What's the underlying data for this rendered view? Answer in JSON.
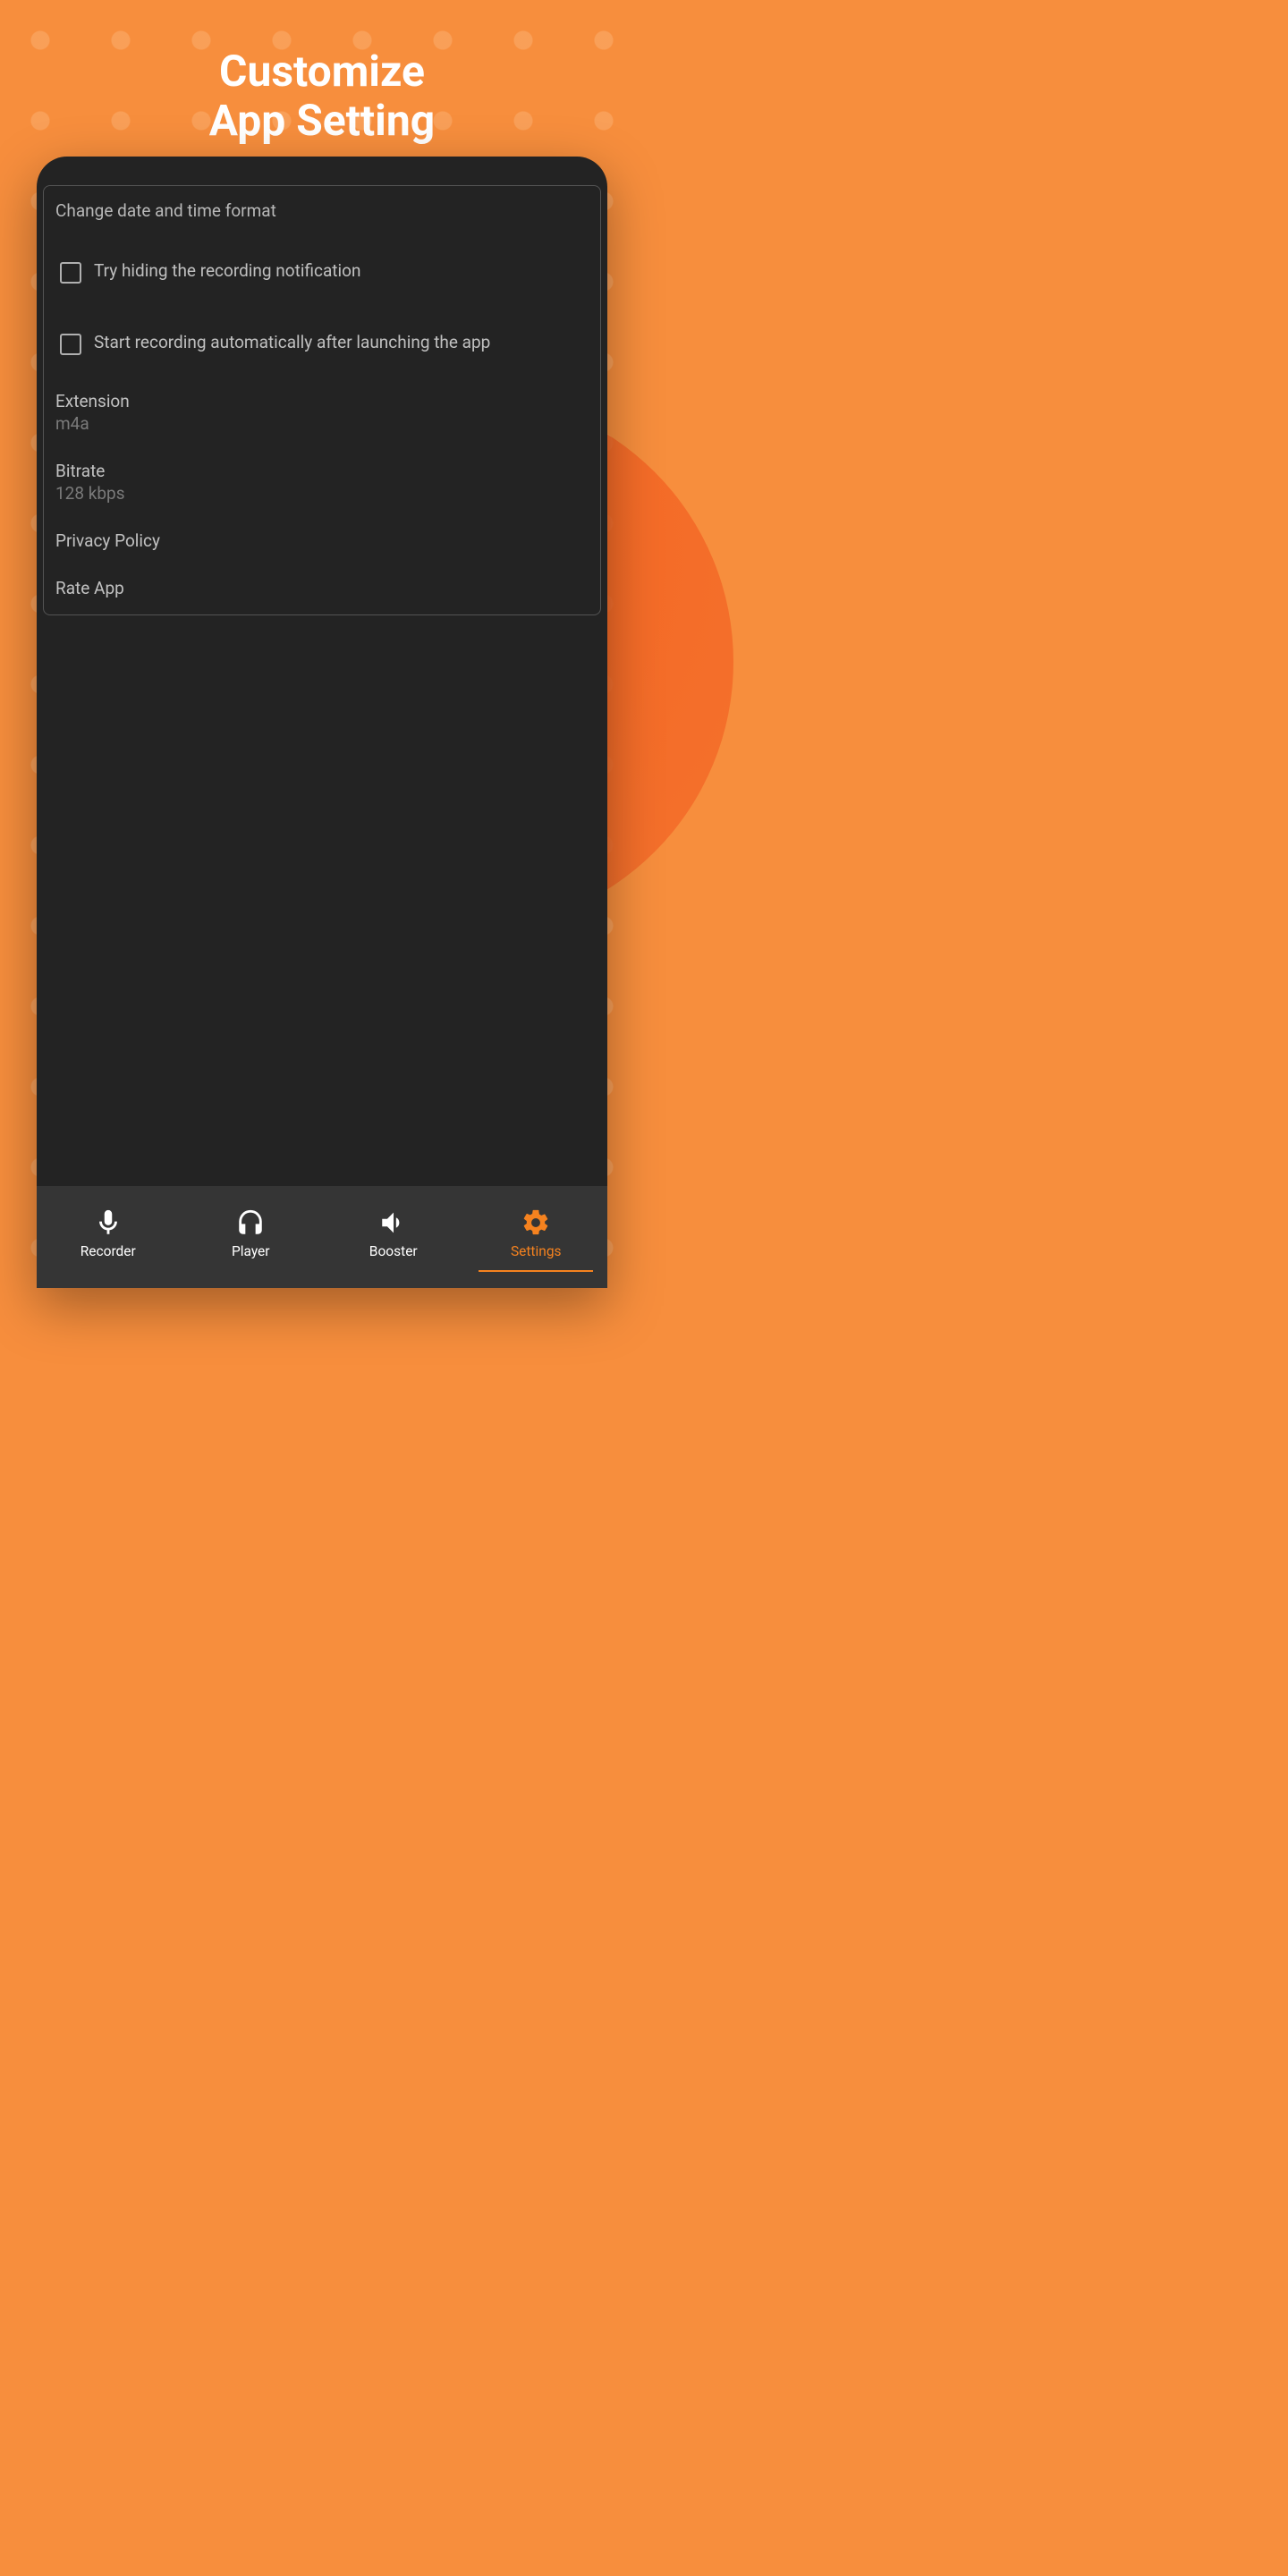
{
  "promo": {
    "line1": "Customize",
    "line2": "App Setting"
  },
  "settings": {
    "card_header": "Change date and time format",
    "hide_notification_label": "Try hiding the recording notification",
    "auto_record_label": "Start recording automatically after launching the app",
    "extension": {
      "title": "Extension",
      "value": "m4a"
    },
    "bitrate": {
      "title": "Bitrate",
      "value": "128 kbps"
    },
    "privacy_label": "Privacy Policy",
    "rate_label": "Rate App"
  },
  "nav": {
    "recorder": "Recorder",
    "player": "Player",
    "booster": "Booster",
    "settings": "Settings"
  },
  "colors": {
    "accent": "#f5821f",
    "bg": "#232323",
    "nav_bg": "#353535"
  }
}
